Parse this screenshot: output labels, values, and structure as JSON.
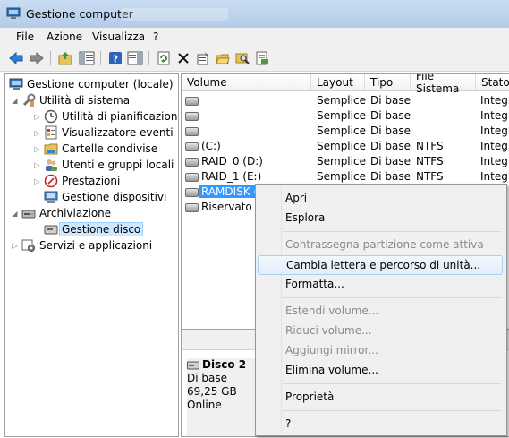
{
  "window": {
    "title": "Gestione computer"
  },
  "menubar": [
    "File",
    "Azione",
    "Visualizza",
    "?"
  ],
  "toolbar": {
    "icons": [
      "back-arrow-icon",
      "forward-arrow-icon",
      "up-folder-icon",
      "show-hide-tree-icon",
      "help-icon",
      "show-hide-action-pane-icon",
      "refresh-icon",
      "delete-icon",
      "properties-icon",
      "open-icon",
      "search-icon",
      "export-icon"
    ]
  },
  "tree": {
    "root": "Gestione computer (locale)",
    "system_tools": "Utilità di sistema",
    "task_scheduler": "Utilità di pianificazione",
    "event_viewer": "Visualizzatore eventi",
    "shared_folders": "Cartelle condivise",
    "users_groups": "Utenti e gruppi locali",
    "performance": "Prestazioni",
    "device_manager": "Gestione dispositivi",
    "storage": "Archiviazione",
    "disk_management": "Gestione disco",
    "services": "Servizi e applicazioni"
  },
  "table": {
    "columns": [
      "Volume",
      "Layout",
      "Tipo",
      "File Sistema",
      "Stato"
    ],
    "rows": [
      {
        "volume": "",
        "layout": "Semplice",
        "tipo": "Di base",
        "fs": "",
        "stato": "Integr"
      },
      {
        "volume": "",
        "layout": "Semplice",
        "tipo": "Di base",
        "fs": "",
        "stato": "Integr"
      },
      {
        "volume": "",
        "layout": "Semplice",
        "tipo": "Di base",
        "fs": "",
        "stato": "Integr"
      },
      {
        "volume": "(C:)",
        "layout": "Semplice",
        "tipo": "Di base",
        "fs": "NTFS",
        "stato": "Integr"
      },
      {
        "volume": "RAID_0 (D:)",
        "layout": "Semplice",
        "tipo": "Di base",
        "fs": "NTFS",
        "stato": "Integr"
      },
      {
        "volume": "RAID_1 (E:)",
        "layout": "Semplice",
        "tipo": "Di base",
        "fs": "NTFS",
        "stato": "Integr"
      },
      {
        "volume": "RAMDISK (G",
        "layout": "",
        "tipo": "",
        "fs": "",
        "stato": ""
      },
      {
        "volume": "Riservato pe",
        "layout": "",
        "tipo": "",
        "fs": "",
        "stato": ""
      }
    ]
  },
  "disk": {
    "name": "Disco 2",
    "type": "Di base",
    "size": "69,25 GB",
    "status": "Online"
  },
  "context_menu": {
    "items": [
      {
        "label": "Apri",
        "enabled": true
      },
      {
        "label": "Esplora",
        "enabled": true
      },
      {
        "label": "Contrassegna partizione come attiva",
        "enabled": false
      },
      {
        "label": "Cambia lettera e percorso di unità...",
        "enabled": true,
        "highlighted": true
      },
      {
        "label": "Formatta...",
        "enabled": true
      },
      {
        "label": "Estendi volume...",
        "enabled": false
      },
      {
        "label": "Riduci volume...",
        "enabled": false
      },
      {
        "label": "Aggiungi mirror...",
        "enabled": false
      },
      {
        "label": "Elimina volume...",
        "enabled": true
      },
      {
        "label": "Proprietà",
        "enabled": true
      },
      {
        "label": "?",
        "enabled": true
      }
    ]
  }
}
